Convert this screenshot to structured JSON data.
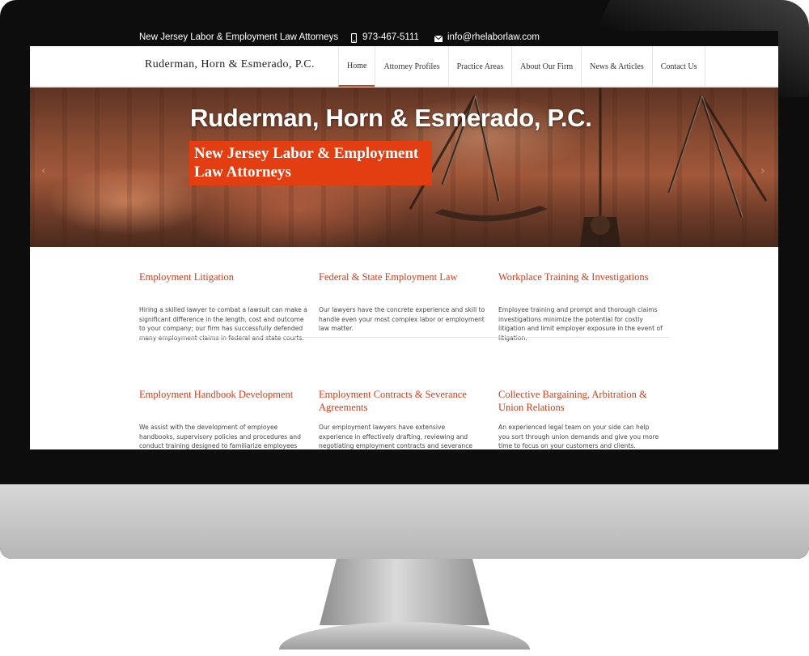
{
  "topbar": {
    "tagline": "New Jersey Labor & Employment Law Attorneys",
    "phone": "973-467-5111",
    "email": "info@rhelaborlaw.com"
  },
  "brand": {
    "logo_text": "Ruderman, Horn & Esmerado, P.C."
  },
  "nav": {
    "items": [
      "Home",
      "Attorney Profiles",
      "Practice Areas",
      "About Our Firm",
      "News & Articles",
      "Contact Us"
    ],
    "active": "Home"
  },
  "hero": {
    "title": "Ruderman, Horn & Esmerado, P.C.",
    "subtitle_line1": "New Jersey Labor & Employment",
    "subtitle_line2": "Law Attorneys"
  },
  "services": [
    {
      "title": "Employment Litigation",
      "text": "Hiring a skilled lawyer to combat a lawsuit can make a significant difference in the length, cost and outcome to your company; our firm has successfully defended many employment claims in federal and state courts."
    },
    {
      "title": "Federal & State Employment Law",
      "text": "Our lawyers have the concrete experience and skill to handle even your most complex labor or employment law matter."
    },
    {
      "title": "Workplace Training & Investigations",
      "text": "Employee training and prompt and thorough claims investigations minimize the potential for costly litigation and limit employer exposure in the event of litigation."
    },
    {
      "title": "Employment Handbook Development",
      "text": "We assist with the development of employee handbooks, supervisory policies and procedures and conduct training designed to familiarize employees"
    },
    {
      "title": "Employment Contracts & Severance Agreements",
      "text": "Our employment lawyers have extensive experience in effectively drafting, reviewing and negotiating employment contracts and severance agreements,"
    },
    {
      "title": "Collective Bargaining, Arbitration & Union Relations",
      "text": "An experienced legal team on your side can help you sort through union demands and give you more time to focus on your customers and clients."
    }
  ],
  "colors": {
    "accent": "#d33c1a",
    "badge": "#e23e12",
    "topbar": "#111111"
  }
}
